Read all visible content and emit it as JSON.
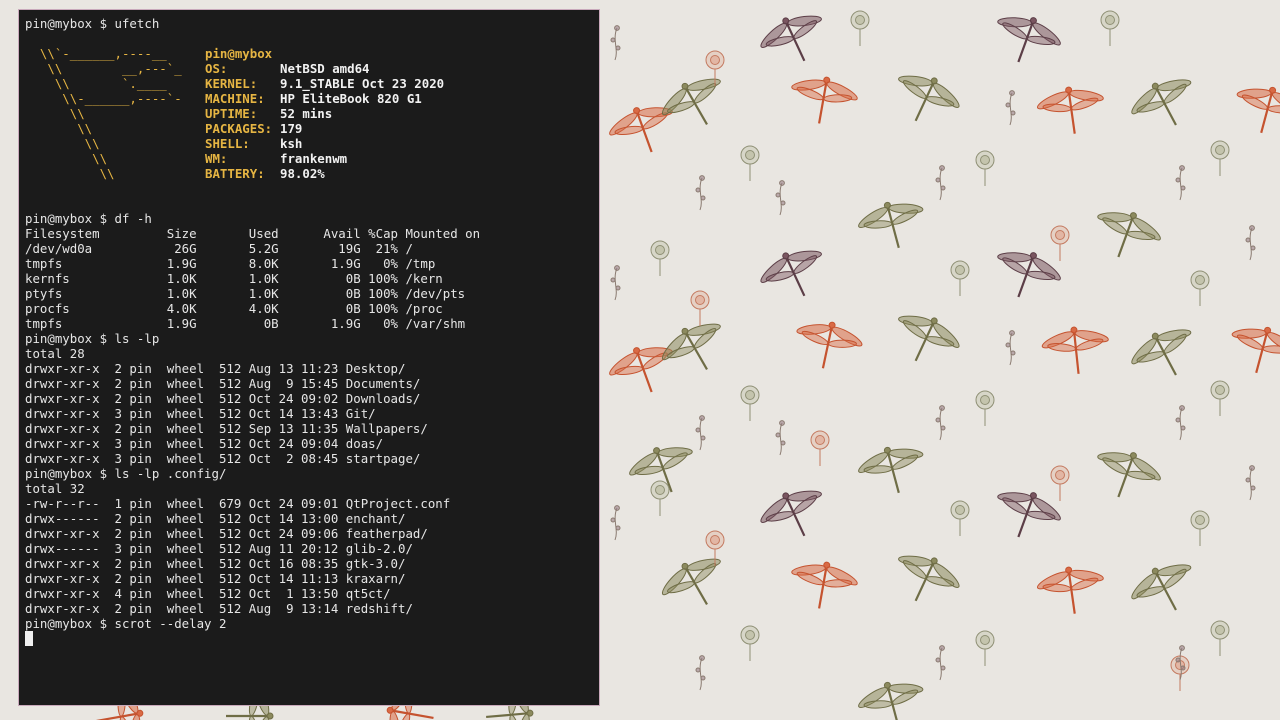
{
  "colors": {
    "terminal_bg": "#1b1b1b",
    "foreground": "#e6e6e6",
    "accent_yellow": "#e6b543",
    "border": "#c9a9bb",
    "wallpaper_bg": "#e9e6e1"
  },
  "wallpaper": {
    "icons": [
      "dragonfly-icon",
      "flower-icon"
    ]
  },
  "terminal": {
    "prompt1": "pin@mybox $ ufetch",
    "ascii_art": [
      "  \\\\`-______,----__",
      "   \\\\        __,---`_",
      "    \\\\       `.____",
      "     \\\\-______,----`-",
      "      \\\\",
      "       \\\\",
      "        \\\\",
      "         \\\\",
      "          \\\\"
    ],
    "ufetch": {
      "user_host": "pin@mybox",
      "fields": [
        {
          "key": "OS:",
          "value": "NetBSD amd64"
        },
        {
          "key": "KERNEL:",
          "value": "9.1_STABLE Oct 23 2020"
        },
        {
          "key": "MACHINE:",
          "value": "HP EliteBook 820 G1"
        },
        {
          "key": "UPTIME:",
          "value": "52 mins"
        },
        {
          "key": "PACKAGES:",
          "value": "179"
        },
        {
          "key": "SHELL:",
          "value": "ksh"
        },
        {
          "key": "WM:",
          "value": "frankenwm"
        },
        {
          "key": "BATTERY:",
          "value": "98.02%"
        }
      ]
    },
    "prompt2": "pin@mybox $ df -h",
    "df": [
      "Filesystem         Size       Used      Avail %Cap Mounted on",
      "/dev/wd0a           26G       5.2G        19G  21% /",
      "tmpfs              1.9G       8.0K       1.9G   0% /tmp",
      "kernfs             1.0K       1.0K         0B 100% /kern",
      "ptyfs              1.0K       1.0K         0B 100% /dev/pts",
      "procfs             4.0K       4.0K         0B 100% /proc",
      "tmpfs              1.9G         0B       1.9G   0% /var/shm"
    ],
    "prompt3": "pin@mybox $ ls -lp",
    "ls_home": [
      "total 28",
      "drwxr-xr-x  2 pin  wheel  512 Aug 13 11:23 Desktop/",
      "drwxr-xr-x  2 pin  wheel  512 Aug  9 15:45 Documents/",
      "drwxr-xr-x  2 pin  wheel  512 Oct 24 09:02 Downloads/",
      "drwxr-xr-x  3 pin  wheel  512 Oct 14 13:43 Git/",
      "drwxr-xr-x  2 pin  wheel  512 Sep 13 11:35 Wallpapers/",
      "drwxr-xr-x  3 pin  wheel  512 Oct 24 09:04 doas/",
      "drwxr-xr-x  3 pin  wheel  512 Oct  2 08:45 startpage/"
    ],
    "prompt4": "pin@mybox $ ls -lp .config/",
    "ls_config": [
      "total 32",
      "-rw-r--r--  1 pin  wheel  679 Oct 24 09:01 QtProject.conf",
      "drwx------  2 pin  wheel  512 Oct 14 13:00 enchant/",
      "drwxr-xr-x  2 pin  wheel  512 Oct 24 09:06 featherpad/",
      "drwx------  3 pin  wheel  512 Aug 11 20:12 glib-2.0/",
      "drwxr-xr-x  2 pin  wheel  512 Oct 16 08:35 gtk-3.0/",
      "drwxr-xr-x  2 pin  wheel  512 Oct 14 11:13 kraxarn/",
      "drwxr-xr-x  4 pin  wheel  512 Oct  1 13:50 qt5ct/",
      "drwxr-xr-x  2 pin  wheel  512 Aug  9 13:14 redshift/"
    ],
    "prompt5": "pin@mybox $ scrot --delay 2"
  }
}
